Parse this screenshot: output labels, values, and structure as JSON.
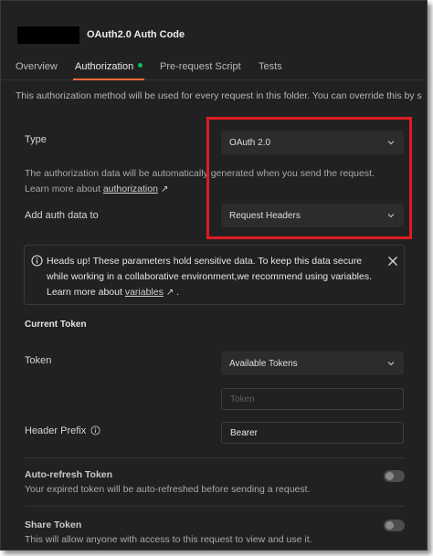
{
  "header": {
    "title": "OAuth2.0 Auth Code"
  },
  "tabs": [
    {
      "label": "Overview",
      "active": false
    },
    {
      "label": "Authorization",
      "active": true,
      "status_dot_color": "#0cbb52"
    },
    {
      "label": "Pre-request Script",
      "active": false
    },
    {
      "label": "Tests",
      "active": false
    }
  ],
  "info_line": "This authorization method will be used for every request in this folder. You can override this by s",
  "type_field": {
    "label": "Type",
    "value": "OAuth 2.0"
  },
  "auth_note": {
    "text": "The authorization data will be automatically generated when you send the request.",
    "learn_prefix": "Learn more about",
    "learn_link": "authorization",
    "arrow": "↗"
  },
  "add_auth": {
    "label": "Add auth data to",
    "value": "Request Headers"
  },
  "alert": {
    "line1": "Heads up! These parameters hold sensitive data. To keep this data secure",
    "line2": "while working in a collaborative environment,we recommend using variables.",
    "learn_prefix": "Learn more about",
    "learn_link": "variables",
    "arrow": "↗",
    "suffix": "."
  },
  "current_token": {
    "heading": "Current Token",
    "token_label": "Token",
    "token_select": "Available Tokens",
    "token_placeholder": "Token",
    "header_prefix_label": "Header Prefix",
    "header_prefix_value": "Bearer"
  },
  "auto_refresh": {
    "title": "Auto-refresh Token",
    "description": "Your expired token will be auto-refreshed before sending a request.",
    "enabled": false
  },
  "share_token": {
    "title": "Share Token",
    "description": "This will allow anyone with access to this request to view and use it.",
    "enabled": false
  },
  "colors": {
    "background": "#212121",
    "accent": "#ff6c37",
    "highlight_box": "#e01b24",
    "status_green": "#0cbb52"
  }
}
